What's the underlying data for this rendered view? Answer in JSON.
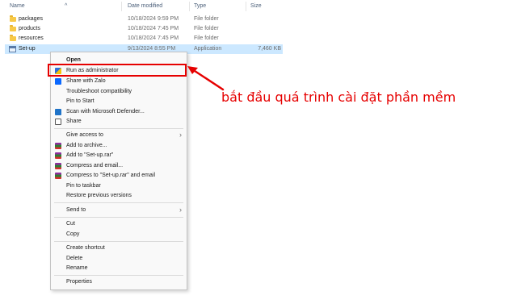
{
  "columns": {
    "name": "Name",
    "date": "Date modified",
    "type": "Type",
    "size": "Size"
  },
  "files": [
    {
      "name": "packages",
      "date": "10/18/2024 9:59 PM",
      "type": "File folder",
      "size": "",
      "icon": "folder-icon"
    },
    {
      "name": "products",
      "date": "10/18/2024 7:45 PM",
      "type": "File folder",
      "size": "",
      "icon": "folder-icon"
    },
    {
      "name": "resources",
      "date": "10/18/2024 7:45 PM",
      "type": "File folder",
      "size": "",
      "icon": "folder-icon"
    },
    {
      "name": "Set-up",
      "date": "9/13/2024 8:55 PM",
      "type": "Application",
      "size": "7,460 KB",
      "icon": "application-icon"
    }
  ],
  "context_menu": {
    "open": "Open",
    "run_as_admin": "Run as administrator",
    "share_zalo": "Share with Zalo",
    "troubleshoot": "Troubleshoot compatibility",
    "pin_start": "Pin to Start",
    "scan_defender": "Scan with Microsoft Defender...",
    "share": "Share",
    "give_access": "Give access to",
    "add_archive": "Add to archive...",
    "add_rar": "Add to \"Set-up.rar\"",
    "compress_email": "Compress and email...",
    "compress_rar_email": "Compress to \"Set-up.rar\" and email",
    "pin_taskbar": "Pin to taskbar",
    "restore_versions": "Restore previous versions",
    "send_to": "Send to",
    "cut": "Cut",
    "copy": "Copy",
    "create_shortcut": "Create shortcut",
    "delete": "Delete",
    "rename": "Rename",
    "properties": "Properties"
  },
  "annotation": {
    "text": "bắt đầu quá trình cài đặt phần mềm",
    "color": "#e60000"
  },
  "colors": {
    "selection": "#cce8ff",
    "highlight": "#e60000"
  }
}
